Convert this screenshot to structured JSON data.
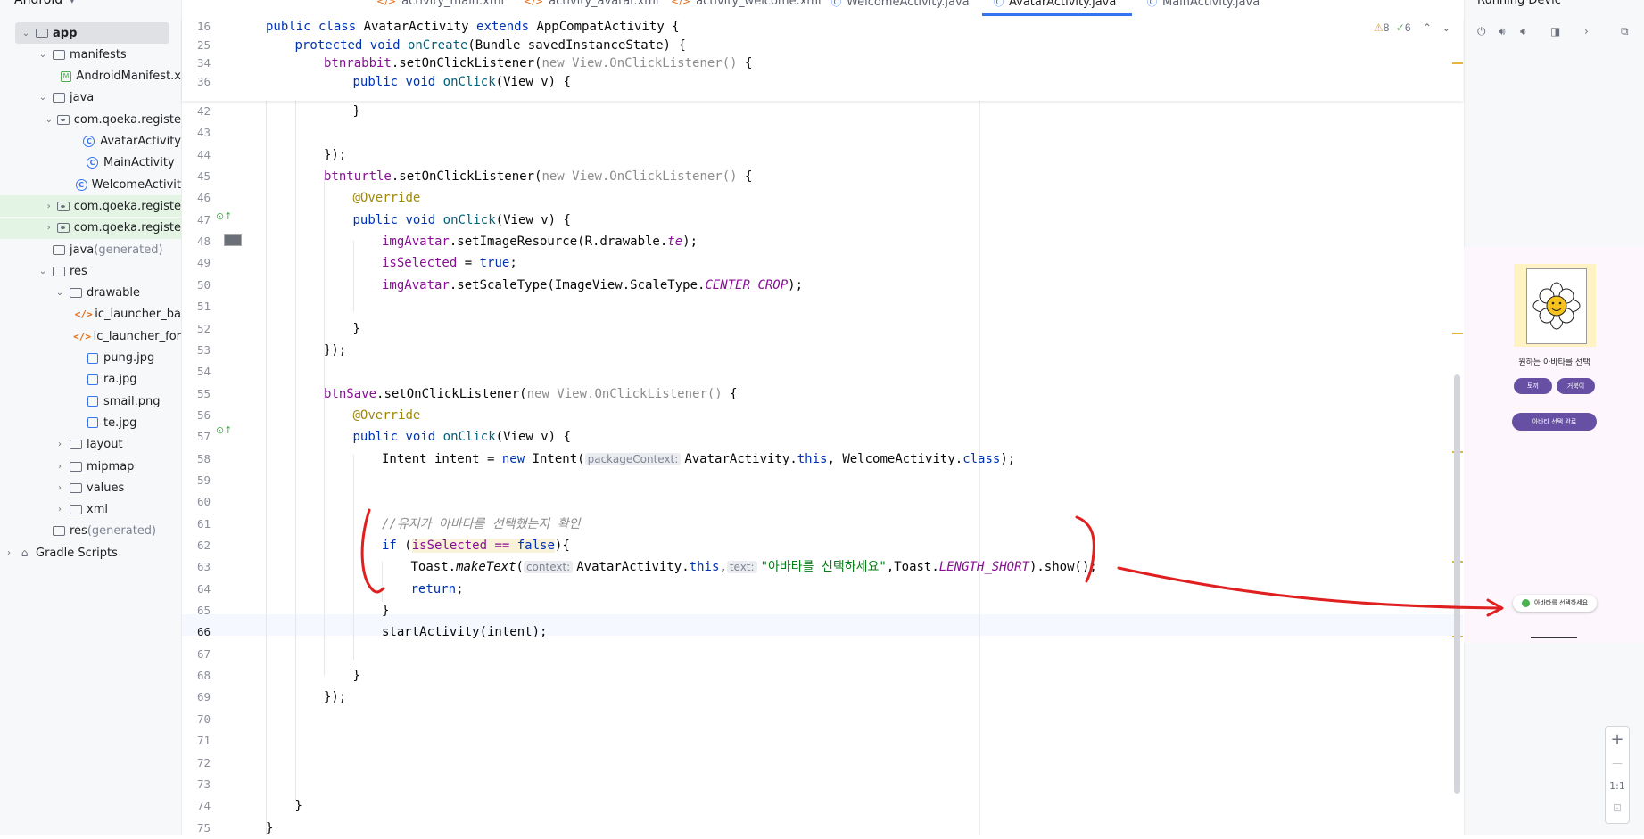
{
  "project_tree": {
    "header": "Android",
    "items": [
      {
        "label": "app",
        "bold": true,
        "chev": "v",
        "icon": "folder",
        "indent": 1,
        "style": "sel"
      },
      {
        "label": "manifests",
        "chev": "v",
        "icon": "folder",
        "indent": 2
      },
      {
        "label": "AndroidManifest.x",
        "chev": "",
        "icon": "manifest",
        "indent": 3
      },
      {
        "label": "java",
        "chev": "v",
        "icon": "folder",
        "indent": 2
      },
      {
        "label": "com.qoeka.registe",
        "chev": "v",
        "icon": "package",
        "indent": 3
      },
      {
        "label": "AvatarActivity",
        "chev": "",
        "icon": "class",
        "indent": 4
      },
      {
        "label": "MainActivity",
        "chev": "",
        "icon": "class",
        "indent": 4
      },
      {
        "label": "WelcomeActivit",
        "chev": "",
        "icon": "class",
        "indent": 4
      },
      {
        "label": "com.qoeka.registe",
        "chev": ">",
        "icon": "package",
        "indent": 3,
        "style": "green"
      },
      {
        "label": "com.qoeka.registe",
        "chev": ">",
        "icon": "package",
        "indent": 3,
        "style": "green"
      },
      {
        "label": "java",
        "suffix": " (generated)",
        "chev": "",
        "icon": "folder",
        "indent": 2
      },
      {
        "label": "res",
        "chev": "v",
        "icon": "folder",
        "indent": 2
      },
      {
        "label": "drawable",
        "chev": "v",
        "icon": "folder",
        "indent": 3
      },
      {
        "label": "ic_launcher_ba",
        "chev": "",
        "icon": "xml",
        "indent": 4
      },
      {
        "label": "ic_launcher_for",
        "chev": "",
        "icon": "xml",
        "indent": 4
      },
      {
        "label": "pung.jpg",
        "chev": "",
        "icon": "image",
        "indent": 4
      },
      {
        "label": "ra.jpg",
        "chev": "",
        "icon": "image",
        "indent": 4
      },
      {
        "label": "smail.png",
        "chev": "",
        "icon": "image",
        "indent": 4
      },
      {
        "label": "te.jpg",
        "chev": "",
        "icon": "image",
        "indent": 4
      },
      {
        "label": "layout",
        "chev": ">",
        "icon": "folder",
        "indent": 3
      },
      {
        "label": "mipmap",
        "chev": ">",
        "icon": "folder",
        "indent": 3
      },
      {
        "label": "values",
        "chev": ">",
        "icon": "folder",
        "indent": 3
      },
      {
        "label": "xml",
        "chev": ">",
        "icon": "folder",
        "indent": 3
      },
      {
        "label": "res",
        "suffix": " (generated)",
        "chev": "",
        "icon": "folder",
        "indent": 2
      },
      {
        "label": "Gradle Scripts",
        "chev": ">",
        "icon": "gradle",
        "indent": 0
      }
    ]
  },
  "tabs": [
    {
      "label": "activity_main.xml",
      "icon": "xml"
    },
    {
      "label": "activity_avatar.xml",
      "icon": "xml"
    },
    {
      "label": "activity_welcome.xml",
      "icon": "xml"
    },
    {
      "label": "WelcomeActivity.java",
      "icon": "class"
    },
    {
      "label": "AvatarActivity.java",
      "icon": "class",
      "active": true
    },
    {
      "label": "MainActivity.java",
      "icon": "class"
    }
  ],
  "inspections": {
    "warnings": "8",
    "ok": "6"
  },
  "sticky_lines": [
    {
      "n": "16",
      "tokens": [
        [
          "kw",
          "public class "
        ],
        [
          "",
          "AvatarActivity "
        ],
        [
          "kw",
          "extends "
        ],
        [
          "",
          "AppCompatActivity {"
        ]
      ],
      "indent": 0
    },
    {
      "n": "25",
      "tokens": [
        [
          "kw",
          "protected void "
        ],
        [
          "fn",
          "onCreate"
        ],
        [
          "",
          "(Bundle savedInstanceState) {"
        ]
      ],
      "indent": 1
    },
    {
      "n": "34",
      "tokens": [
        [
          "fld",
          "btnrabbit"
        ],
        [
          "",
          ".setOnClickListener("
        ],
        [
          "grey",
          "new View.OnClickListener() "
        ],
        [
          "",
          "{"
        ]
      ],
      "indent": 2
    },
    {
      "n": "36",
      "tokens": [
        [
          "kw",
          "public void "
        ],
        [
          "fn",
          "onClick"
        ],
        [
          "",
          "(View v) {"
        ]
      ],
      "indent": 3
    }
  ],
  "code_lines": [
    {
      "n": "42",
      "indent": 3,
      "tokens": [
        [
          "",
          "}"
        ]
      ]
    },
    {
      "n": "43",
      "indent": 0,
      "tokens": []
    },
    {
      "n": "44",
      "indent": 2,
      "tokens": [
        [
          "",
          "});"
        ]
      ]
    },
    {
      "n": "45",
      "indent": 2,
      "tokens": [
        [
          "fld",
          "btnturtle"
        ],
        [
          "",
          ".setOnClickListener("
        ],
        [
          "grey",
          "new View.OnClickListener() "
        ],
        [
          "",
          "{"
        ]
      ]
    },
    {
      "n": "46",
      "indent": 3,
      "tokens": [
        [
          "ann",
          "@Override"
        ]
      ]
    },
    {
      "n": "47",
      "indent": 3,
      "tokens": [
        [
          "kw",
          "public void "
        ],
        [
          "fn",
          "onClick"
        ],
        [
          "",
          "(View v) {"
        ]
      ]
    },
    {
      "n": "48",
      "indent": 4,
      "tokens": [
        [
          "fld",
          "imgAvatar"
        ],
        [
          "",
          ".setImageResource(R.drawable."
        ],
        [
          "const",
          "te"
        ],
        [
          "",
          ");"
        ]
      ]
    },
    {
      "n": "49",
      "indent": 4,
      "tokens": [
        [
          "fld",
          "isSelected"
        ],
        [
          "",
          " = "
        ],
        [
          "kw",
          "true"
        ],
        [
          "",
          ";"
        ]
      ]
    },
    {
      "n": "50",
      "indent": 4,
      "tokens": [
        [
          "fld",
          "imgAvatar"
        ],
        [
          "",
          ".setScaleType(ImageView.ScaleType."
        ],
        [
          "const",
          "CENTER_CROP"
        ],
        [
          "",
          ");"
        ]
      ]
    },
    {
      "n": "51",
      "indent": 0,
      "tokens": []
    },
    {
      "n": "52",
      "indent": 3,
      "tokens": [
        [
          "",
          "}"
        ]
      ]
    },
    {
      "n": "53",
      "indent": 2,
      "tokens": [
        [
          "",
          "});"
        ]
      ]
    },
    {
      "n": "54",
      "indent": 0,
      "tokens": []
    },
    {
      "n": "55",
      "indent": 2,
      "tokens": [
        [
          "fld",
          "btnSave"
        ],
        [
          "",
          ".setOnClickListener("
        ],
        [
          "grey",
          "new View.OnClickListener() "
        ],
        [
          "",
          "{"
        ]
      ]
    },
    {
      "n": "56",
      "indent": 3,
      "tokens": [
        [
          "ann",
          "@Override"
        ]
      ]
    },
    {
      "n": "57",
      "indent": 3,
      "tokens": [
        [
          "kw",
          "public void "
        ],
        [
          "fn",
          "onClick"
        ],
        [
          "",
          "(View v) {"
        ]
      ]
    },
    {
      "n": "58",
      "indent": 4,
      "tokens": [
        [
          "",
          "Intent intent = "
        ],
        [
          "kw",
          "new "
        ],
        [
          "",
          "Intent("
        ],
        [
          "hint",
          "packageContext:"
        ],
        [
          "",
          "AvatarActivity."
        ],
        [
          "kw",
          "this"
        ],
        [
          "",
          ", WelcomeActivity."
        ],
        [
          "kw",
          "class"
        ],
        [
          "",
          ");"
        ]
      ]
    },
    {
      "n": "59",
      "indent": 0,
      "tokens": []
    },
    {
      "n": "60",
      "indent": 0,
      "tokens": []
    },
    {
      "n": "61",
      "indent": 4,
      "tokens": [
        [
          "cmt",
          "//유저가 아바타를 선택했는지 확인"
        ]
      ]
    },
    {
      "n": "62",
      "indent": 4,
      "tokens": [
        [
          "kw",
          "if "
        ],
        [
          "",
          "("
        ],
        [
          "warnfld",
          "isSelected == "
        ],
        [
          "warnkw",
          "false"
        ],
        [
          "",
          "){"
        ]
      ]
    },
    {
      "n": "63",
      "indent": 5,
      "tokens": [
        [
          "",
          "Toast."
        ],
        [
          "itl",
          "makeText"
        ],
        [
          "",
          "("
        ],
        [
          "hint",
          "context:"
        ],
        [
          "",
          "AvatarActivity."
        ],
        [
          "kw",
          "this"
        ],
        [
          "",
          ","
        ],
        [
          "hint",
          "text:"
        ],
        [
          "str",
          "\"아바타를 선택하세요\""
        ],
        [
          "",
          ",Toast."
        ],
        [
          "const",
          "LENGTH_SHORT"
        ],
        [
          "",
          ").show();"
        ]
      ]
    },
    {
      "n": "64",
      "indent": 5,
      "tokens": [
        [
          "kw",
          "return"
        ],
        [
          "",
          ";"
        ]
      ]
    },
    {
      "n": "65",
      "indent": 4,
      "tokens": [
        [
          "",
          "}"
        ]
      ]
    },
    {
      "n": "66",
      "indent": 4,
      "tokens": [
        [
          "",
          "startActivity(intent);"
        ]
      ],
      "current": true
    },
    {
      "n": "67",
      "indent": 0,
      "tokens": []
    },
    {
      "n": "68",
      "indent": 3,
      "tokens": [
        [
          "",
          "}"
        ]
      ]
    },
    {
      "n": "69",
      "indent": 2,
      "tokens": [
        [
          "",
          "});"
        ]
      ]
    },
    {
      "n": "70",
      "indent": 0,
      "tokens": []
    },
    {
      "n": "71",
      "indent": 0,
      "tokens": []
    },
    {
      "n": "72",
      "indent": 0,
      "tokens": []
    },
    {
      "n": "73",
      "indent": 0,
      "tokens": []
    },
    {
      "n": "74",
      "indent": 1,
      "tokens": [
        [
          "",
          "}"
        ]
      ]
    },
    {
      "n": "75",
      "indent": 0,
      "tokens": [
        [
          "",
          "}"
        ]
      ]
    }
  ],
  "device": {
    "panel_title": "Running Devic",
    "prompt": "원하는 아바타를 선택",
    "btn_rabbit": "토끼",
    "btn_turtle": "거북이",
    "btn_save": "아바타 선택 완료",
    "toast": "아바타를 선택하세요",
    "zoom_plus": "+",
    "zoom_minus": "—",
    "zoom_ratio": "1:1"
  },
  "colors": {
    "accent": "#3574f0",
    "annotation_red": "#e02020",
    "device_button": "#6750a4"
  }
}
